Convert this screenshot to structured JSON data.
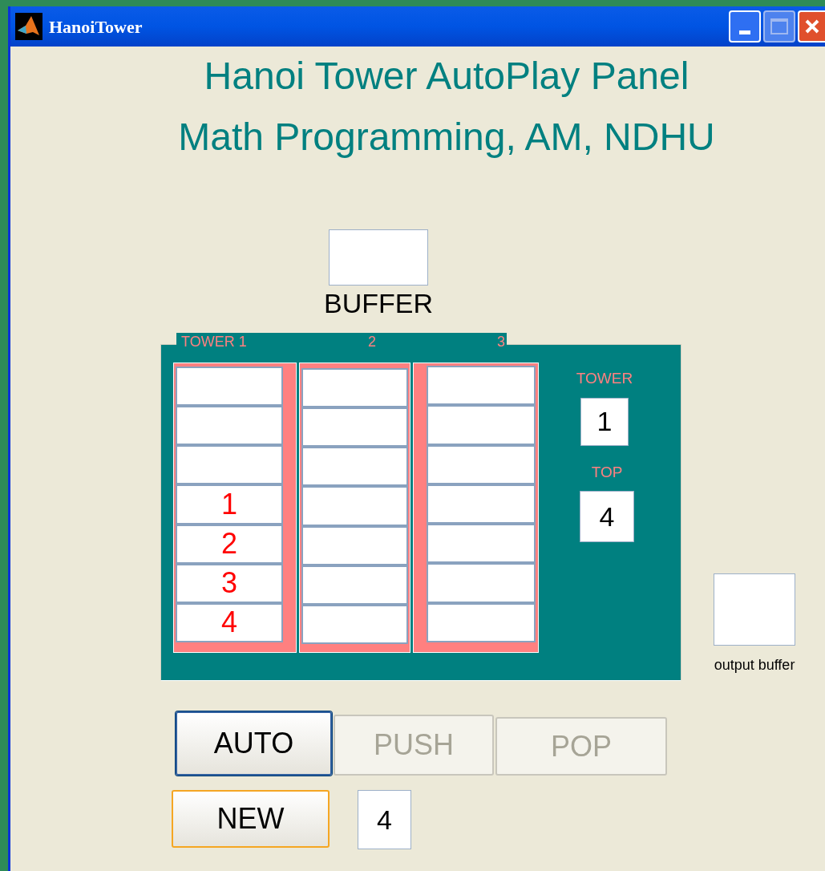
{
  "window": {
    "title": "HanoiTower"
  },
  "headings": [
    "Hanoi Tower AutoPlay Panel",
    "Math Programming, AM, NDHU"
  ],
  "buffer": {
    "label": "BUFFER"
  },
  "towers_panel": {
    "towers": [
      {
        "label": "TOWER 1",
        "disks": [
          "1",
          "2",
          "3",
          "4"
        ]
      },
      {
        "label": "2"
      },
      {
        "label": "3"
      }
    ],
    "tower_label": "TOWER",
    "tower_value": "1",
    "top_label": "TOP",
    "top_value": "4"
  },
  "output_buffer": {
    "label": "output buffer"
  },
  "buttons": [
    {
      "label": "AUTO",
      "disabled": false,
      "default": true,
      "hovered": false
    },
    {
      "label": "PUSH",
      "disabled": true,
      "default": false,
      "hovered": false
    },
    {
      "label": "POP",
      "disabled": true,
      "default": false,
      "hovered": false
    },
    {
      "label": "NEW",
      "disabled": false,
      "default": false,
      "hovered": true
    }
  ],
  "disk_count_field": {
    "value": "4"
  }
}
